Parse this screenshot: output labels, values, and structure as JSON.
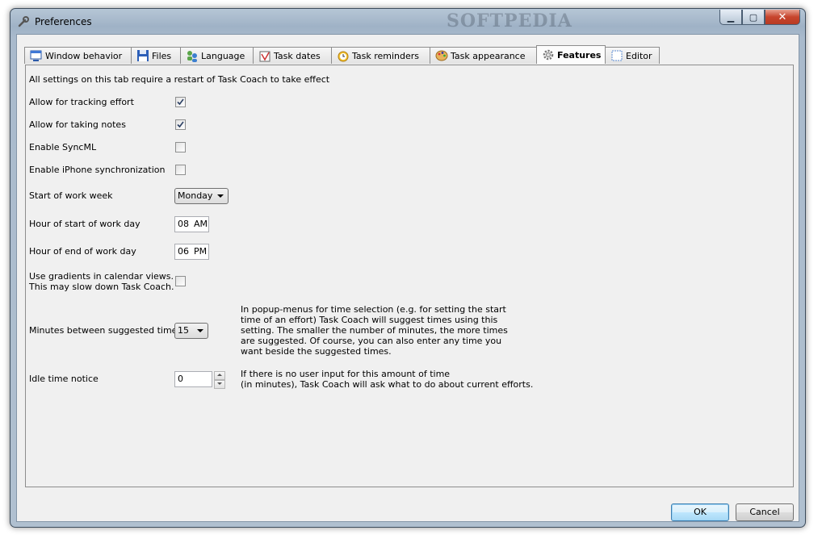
{
  "window": {
    "title": "Preferences",
    "watermark": "SOFTPEDIA",
    "caption": {
      "minimize": "▁",
      "maximize": "▢",
      "close": "✕"
    }
  },
  "tabs": [
    {
      "label": "Window behavior",
      "icon": "window-icon"
    },
    {
      "label": "Files",
      "icon": "floppy-disk-icon"
    },
    {
      "label": "Language",
      "icon": "language-people-icon"
    },
    {
      "label": "Task dates",
      "icon": "calendar-icon"
    },
    {
      "label": "Task reminders",
      "icon": "alarm-clock-icon"
    },
    {
      "label": "Task appearance",
      "icon": "palette-icon"
    },
    {
      "label": "Features",
      "icon": "gear-icon",
      "active": true
    },
    {
      "label": "Editor",
      "icon": "editor-icon"
    }
  ],
  "features": {
    "restart_notice": "All settings on this tab require a restart of Task Coach to take effect",
    "tracking_effort": {
      "label": "Allow for tracking effort",
      "checked": true
    },
    "taking_notes": {
      "label": "Allow for taking notes",
      "checked": true
    },
    "syncml": {
      "label": "Enable SyncML",
      "checked": false
    },
    "iphone_sync": {
      "label": "Enable iPhone synchronization",
      "checked": false
    },
    "start_of_work_week": {
      "label": "Start of work week",
      "value": "Monday"
    },
    "hour_start": {
      "label": "Hour of start of work day",
      "hour": "08",
      "ampm": "AM"
    },
    "hour_end": {
      "label": "Hour of end of work day",
      "hour": "06",
      "ampm": "PM"
    },
    "gradients": {
      "label_line1": "Use gradients in calendar views.",
      "label_line2": "This may slow down Task Coach.",
      "checked": false
    },
    "suggested_minutes": {
      "label": "Minutes between suggested times",
      "value": "15",
      "help": [
        "In popup-menus for time selection (e.g. for setting the start",
        "time of an effort) Task Coach will suggest times using this",
        "setting. The smaller the number of minutes, the more times",
        "are suggested. Of course, you can also enter any time you",
        "want beside the suggested times."
      ]
    },
    "idle_notice": {
      "label": "Idle time notice",
      "value": "0",
      "help": [
        "If there is no user input for this amount of time",
        "(in minutes), Task Coach will ask what to do about current efforts."
      ]
    }
  },
  "buttons": {
    "ok": "OK",
    "cancel": "Cancel"
  }
}
